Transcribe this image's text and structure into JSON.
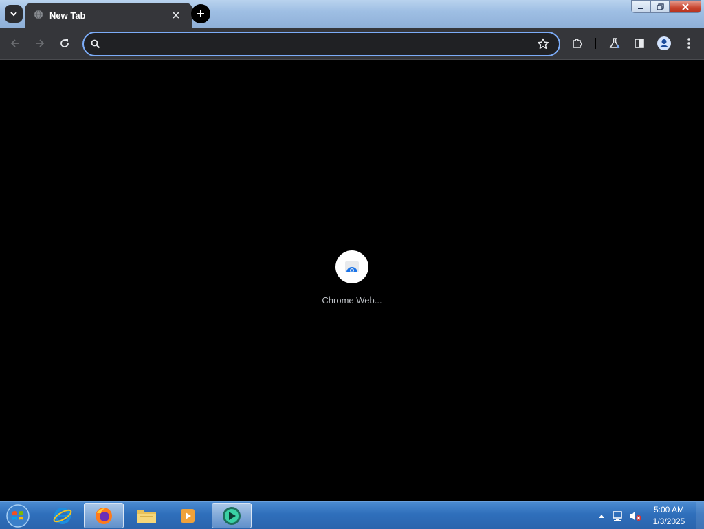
{
  "browser": {
    "tab": {
      "title": "New Tab",
      "favicon": "globe-icon"
    },
    "omnibox": {
      "value": "",
      "placeholder": ""
    },
    "window_buttons": [
      "minimize-icon",
      "restore-icon",
      "close-icon"
    ]
  },
  "new_tab_page": {
    "shortcut": {
      "label": "Chrome Web...",
      "icon": "chrome-web-store-icon"
    }
  },
  "taskbar": {
    "apps": [
      "internet-explorer-icon",
      "firefox-icon",
      "file-explorer-icon",
      "media-player-icon",
      "chrome-app-icon"
    ],
    "clock": {
      "time": "5:00 AM",
      "date": "1/3/2025"
    }
  },
  "colors": {
    "accent": "#7cacf8",
    "toolbar": "#35363a",
    "taskbar": "#2f6fbb"
  }
}
